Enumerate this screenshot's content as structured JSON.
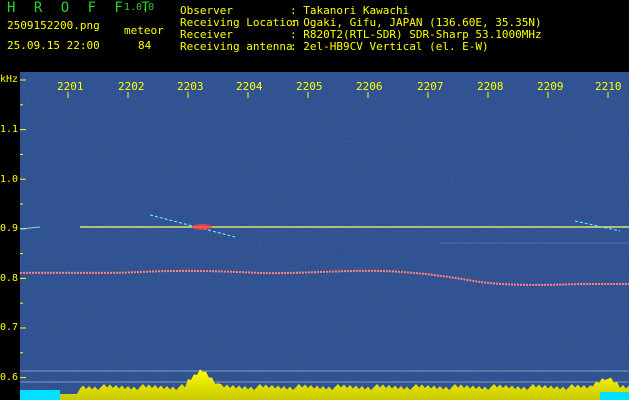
{
  "header": {
    "app_name": "H R O F F T",
    "version": "1.0.0",
    "filename": "2509152200.png",
    "datetime": "25.09.15 22:00",
    "mode_label": "meteor",
    "count": "84",
    "info": [
      {
        "label": "Observer",
        "value": ": Takanori Kawachi"
      },
      {
        "label": "Receiving Location",
        "value": ": Ogaki, Gifu, JAPAN (136.60E, 35.35N)"
      },
      {
        "label": "Receiver",
        "value": ": R820T2(RTL-SDR) SDR-Sharp 53.1000MHz"
      },
      {
        "label": "Receiving antenna",
        "value": ": 2el-HB9CV Vertical (el. E-W)"
      }
    ]
  },
  "plot": {
    "y_unit": "kHz",
    "y_ticks": [
      "1.1",
      "1.0",
      "0.9",
      "0.8",
      "0.7",
      "0.6"
    ],
    "x_ticks": [
      "2201",
      "2202",
      "2203",
      "2204",
      "2205",
      "2206",
      "2207",
      "2208",
      "2209",
      "2210"
    ],
    "colors": {
      "background": "#0a0a5a",
      "grid": "#ffff00",
      "signal": "#ffff80",
      "trace": "#ff6060"
    }
  }
}
